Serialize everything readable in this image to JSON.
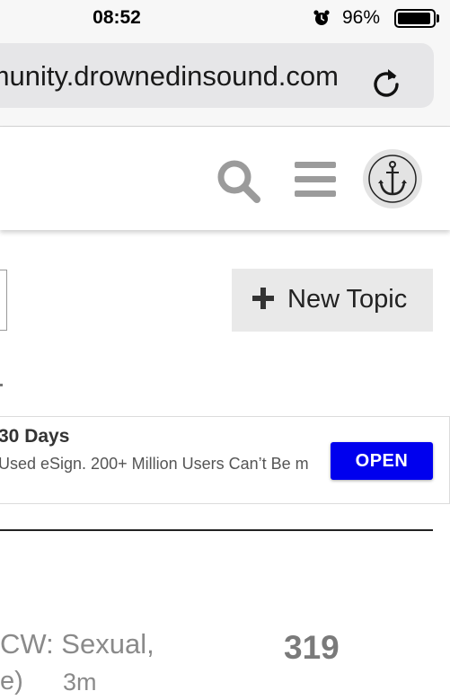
{
  "status_bar": {
    "time": "08:52",
    "alarm_icon": "alarm-clock-icon",
    "battery_percent": "96%",
    "battery_level": 0.96
  },
  "browser": {
    "url": "community.drownedinsound.com",
    "reload_icon": "reload-icon"
  },
  "site_header": {
    "search_icon": "search-icon",
    "menu_icon": "hamburger-menu-icon",
    "avatar_icon": "anchor-icon"
  },
  "toolbar": {
    "new_topic_label": "New Topic",
    "plus_icon": "plus-icon"
  },
  "ad": {
    "title": "30 Days",
    "description": "Used eSign. 200+ Million Users Can’t Be m",
    "open_label": "OPEN",
    "button_color": "#0000ee"
  },
  "topics": [
    {
      "title_line1": "CW: Sexual,",
      "title_line2": "e)",
      "age": "3m",
      "replies": "319"
    }
  ],
  "colors": {
    "accent_button": "#0000ee",
    "icon_gray": "#9b9b9b",
    "chrome_bg": "#f7f7f7"
  }
}
